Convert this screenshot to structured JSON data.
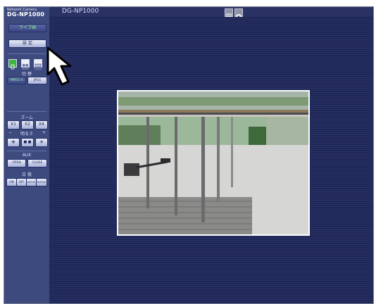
{
  "sidebar": {
    "brand_small": "Network Camera",
    "brand_model": "DG-NP1000",
    "live_button": "ライブ画",
    "setup_button": "設 定",
    "switch_label": "切 替",
    "format_buttons": [
      "MPEG-4",
      "JPEG"
    ],
    "zoom_label": "ズーム",
    "zoom_buttons": [
      "X1",
      "X2",
      "X4"
    ],
    "brightness_label": "明るさ",
    "brightness_minus": "−",
    "brightness_plus": "+",
    "brightness_buttons": [
      "+",
      "■ ■",
      "✳"
    ],
    "aux_label": "AUX",
    "aux_buttons": [
      "OPEN",
      "CLOSE"
    ],
    "daynight_label": "日 夜",
    "daynight_buttons": [
      "ON",
      "OFF",
      "AUTO1",
      "AUTO2"
    ]
  },
  "topbar": {
    "title": "DG-NP1000",
    "icons": [
      "multi-screen-icon",
      "snapshot-camera-icon"
    ]
  },
  "colors": {
    "sidebar": "#3d4a7e",
    "background": "#1f2757",
    "button": "#a8b1d6",
    "active_green": "#3fb43f"
  }
}
